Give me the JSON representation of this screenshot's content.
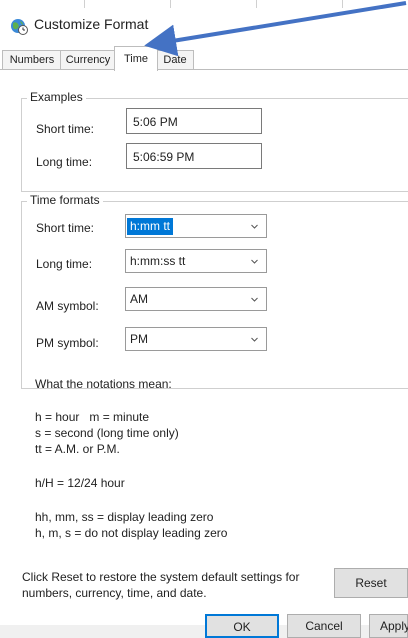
{
  "window": {
    "title": "Customize Format",
    "icon": "globe-clock-icon"
  },
  "tabs": [
    {
      "label": "Numbers",
      "active": false
    },
    {
      "label": "Currency",
      "active": false
    },
    {
      "label": "Time",
      "active": true
    },
    {
      "label": "Date",
      "active": false
    }
  ],
  "examples": {
    "group_label": "Examples",
    "short_time_label": "Short time:",
    "short_time_value": "5:06 PM",
    "long_time_label": "Long time:",
    "long_time_value": "5:06:59 PM"
  },
  "time_formats": {
    "group_label": "Time formats",
    "short_time_label": "Short time:",
    "short_time_value": "h:mm tt",
    "long_time_label": "Long time:",
    "long_time_value": "h:mm:ss tt",
    "am_label": "AM symbol:",
    "am_value": "AM",
    "pm_label": "PM symbol:",
    "pm_value": "PM"
  },
  "notations": {
    "heading": "What the notations mean:",
    "line1": "h = hour   m = minute",
    "line2": "s = second (long time only)",
    "line3": "tt = A.M. or P.M.",
    "line4": "h/H = 12/24 hour",
    "line5": "hh, mm, ss = display leading zero",
    "line6": "h, m, s = do not display leading zero"
  },
  "reset": {
    "text_line1": "Click Reset to restore the system default settings for",
    "text_line2": "numbers, currency, time, and date.",
    "button_label": "Reset"
  },
  "bottom_buttons": {
    "ok": "OK",
    "cancel": "Cancel",
    "apply": "Apply"
  },
  "colors": {
    "annotation_arrow": "#4472c4",
    "selection": "#0078d7"
  }
}
